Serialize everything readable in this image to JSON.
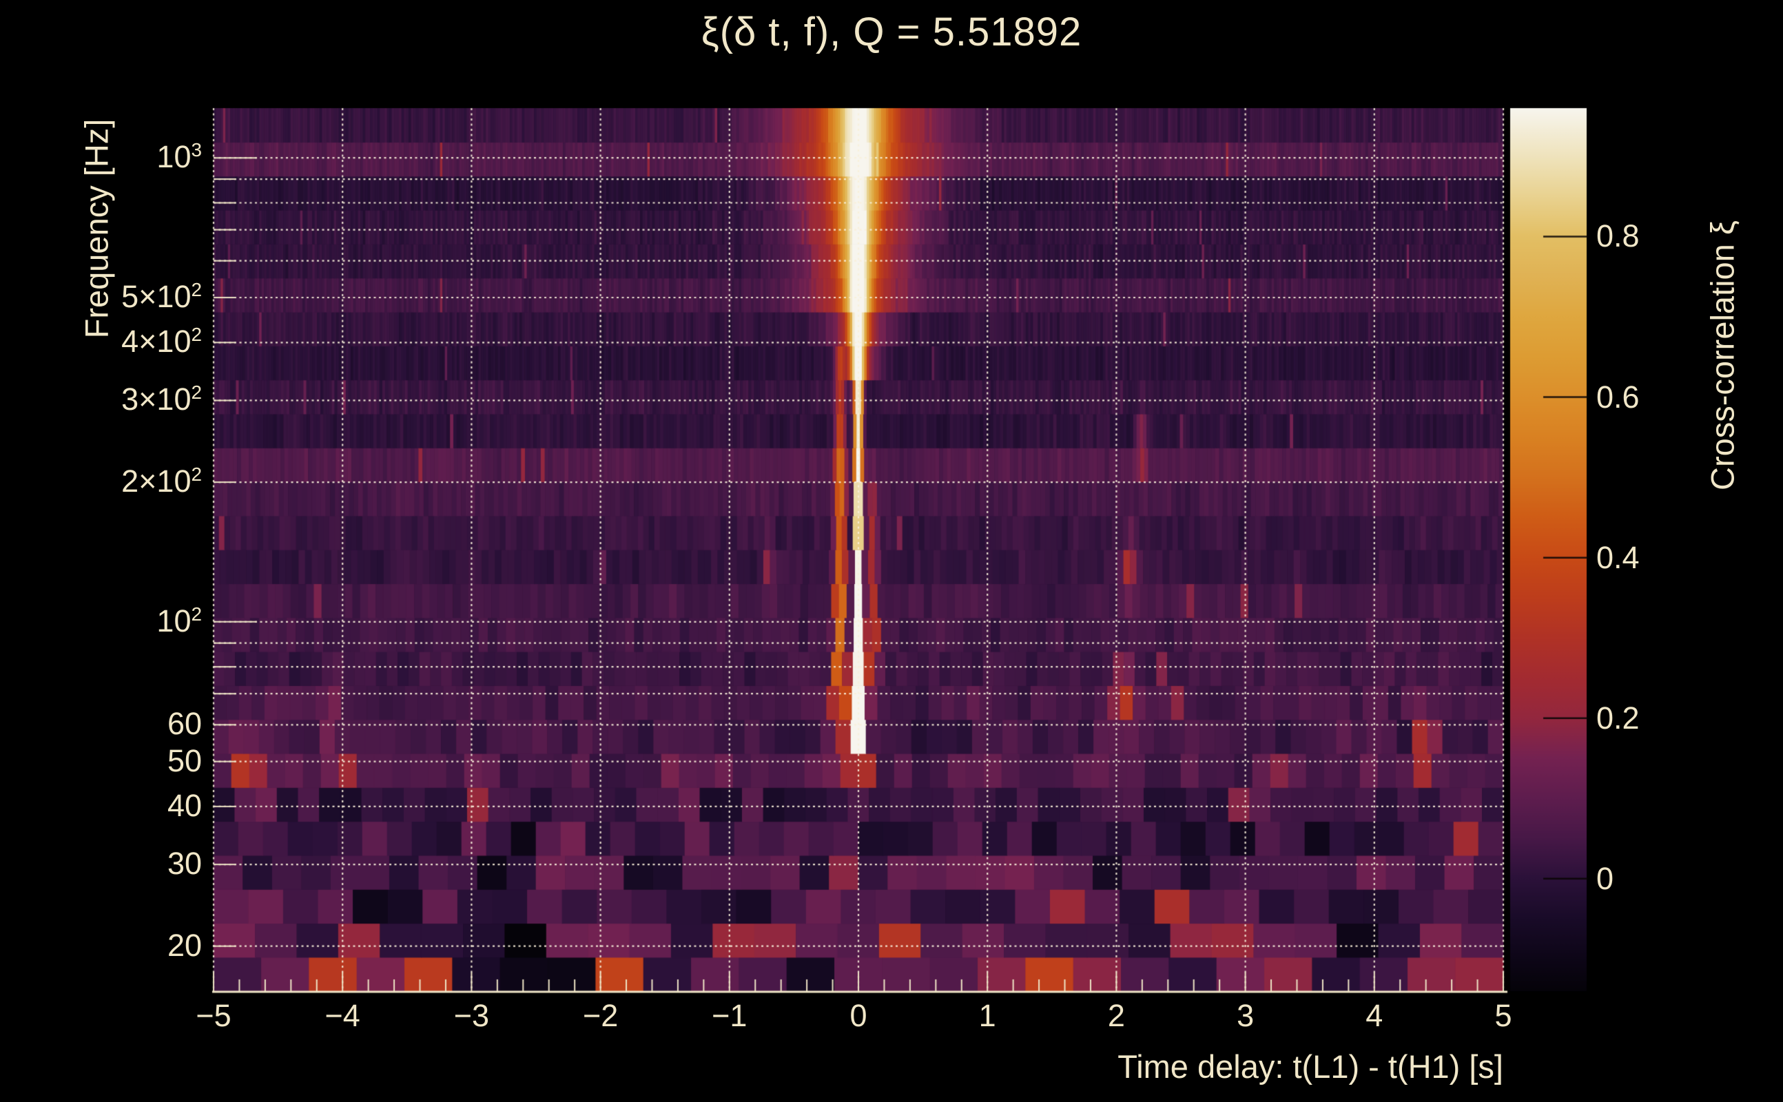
{
  "figure": {
    "background": "#000000",
    "text_color": "#f1e7c8",
    "grid_color": "#f8f0da",
    "axis_color": "#efe5c6"
  },
  "chart_data": {
    "type": "heatmap",
    "title": "ξ(δ t, f), Q = 5.51892",
    "q_value": 5.51892,
    "xlabel": "Time delay: t(L1) - t(H1) [s]",
    "ylabel": "Frequency [Hz]",
    "colorbar_label": "Cross-correlation ξ",
    "x_range": [
      -5,
      5
    ],
    "x_minor_tick_step": 0.2,
    "y_range_hz": [
      16,
      1280
    ],
    "y_scale": "log",
    "z_range": [
      -0.14,
      0.96
    ],
    "grid": {
      "style": "dotted",
      "on": true
    },
    "x_tick_labels": [
      {
        "t": -5,
        "label": "−5"
      },
      {
        "t": -4,
        "label": "−4"
      },
      {
        "t": -3,
        "label": "−3"
      },
      {
        "t": -2,
        "label": "−2"
      },
      {
        "t": -1,
        "label": "−1"
      },
      {
        "t": 0,
        "label": "0"
      },
      {
        "t": 1,
        "label": "1"
      },
      {
        "t": 2,
        "label": "2"
      },
      {
        "t": 3,
        "label": "3"
      },
      {
        "t": 4,
        "label": "4"
      },
      {
        "t": 5,
        "label": "5"
      }
    ],
    "y_tick_labels": [
      {
        "f": 1000,
        "base": "10",
        "exp": "3"
      },
      {
        "f": 500,
        "base": "5×10",
        "exp": "2"
      },
      {
        "f": 400,
        "base": "4×10",
        "exp": "2"
      },
      {
        "f": 300,
        "base": "3×10",
        "exp": "2"
      },
      {
        "f": 200,
        "base": "2×10",
        "exp": "2"
      },
      {
        "f": 100,
        "base": "10",
        "exp": "2"
      },
      {
        "f": 60,
        "base": "60",
        "exp": ""
      },
      {
        "f": 50,
        "base": "50",
        "exp": ""
      },
      {
        "f": 40,
        "base": "40",
        "exp": ""
      },
      {
        "f": 30,
        "base": "30",
        "exp": ""
      },
      {
        "f": 20,
        "base": "20",
        "exp": ""
      }
    ],
    "y_gridline_freqs": [
      20,
      30,
      40,
      50,
      60,
      70,
      80,
      90,
      100,
      200,
      300,
      400,
      500,
      600,
      700,
      800,
      900,
      1000
    ],
    "y_major_tick_freqs": [
      100,
      1000
    ],
    "colorbar_tick_labels": [
      {
        "v": 0.8,
        "label": "0.8"
      },
      {
        "v": 0.6,
        "label": "0.6"
      },
      {
        "v": 0.4,
        "label": "0.4"
      },
      {
        "v": 0.2,
        "label": "0.2"
      },
      {
        "v": 0.0,
        "label": "0"
      }
    ],
    "palette": [
      [
        0.0,
        "#050309"
      ],
      [
        0.036,
        "#0d0617"
      ],
      [
        0.082,
        "#190b28"
      ],
      [
        0.127,
        "#2b1139"
      ],
      [
        0.173,
        "#471847"
      ],
      [
        0.218,
        "#5e1d4e"
      ],
      [
        0.264,
        "#742251"
      ],
      [
        0.309,
        "#93273e"
      ],
      [
        0.355,
        "#a32b31"
      ],
      [
        0.4,
        "#b03226"
      ],
      [
        0.445,
        "#bd3d1c"
      ],
      [
        0.491,
        "#c84a16"
      ],
      [
        0.536,
        "#cf5c16"
      ],
      [
        0.582,
        "#d4711d"
      ],
      [
        0.627,
        "#d98122"
      ],
      [
        0.673,
        "#dc8f2b"
      ],
      [
        0.718,
        "#dd9c33"
      ],
      [
        0.764,
        "#dfa73f"
      ],
      [
        0.809,
        "#e0b254"
      ],
      [
        0.855,
        "#e3bf64"
      ],
      [
        0.9,
        "#e9d290"
      ],
      [
        0.945,
        "#efe3bc"
      ],
      [
        1.0,
        "#f7f5ee"
      ]
    ],
    "bands": {
      "f_min": 16,
      "f_max": 1280,
      "n_rows": 26
    },
    "peak": {
      "t0": 0,
      "amplitude_lgf": [
        [
          1.6,
          0
        ],
        [
          1.66,
          0.3
        ],
        [
          1.7,
          0.8
        ],
        [
          1.74,
          0.96
        ],
        [
          2.0,
          0.95
        ],
        [
          2.48,
          0.93
        ],
        [
          2.6,
          0.82
        ],
        [
          2.75,
          0.68
        ],
        [
          3.0,
          0.62
        ],
        [
          3.12,
          0.6
        ]
      ],
      "sigma_lgf": [
        [
          1.6,
          0.03
        ],
        [
          1.74,
          0.032
        ],
        [
          2.0,
          0.022
        ],
        [
          2.3,
          0.022
        ],
        [
          2.48,
          0.03
        ],
        [
          2.6,
          0.06
        ],
        [
          2.75,
          0.1
        ],
        [
          3.0,
          0.165
        ],
        [
          3.12,
          0.21
        ]
      ],
      "halo": {
        "min_lgf": 2.5,
        "amp": 0.26,
        "sigma_mult": 3.2
      },
      "broad": {
        "min_lgf": 2.7,
        "amp": 0.1,
        "sigma": 0.55
      },
      "secondary_left": {
        "t0": -0.14,
        "sigma": 0.035,
        "amp_lgf": [
          [
            1.7,
            0.15
          ],
          [
            1.85,
            0.45
          ],
          [
            2.35,
            0.42
          ],
          [
            2.55,
            0.25
          ],
          [
            2.62,
            0
          ]
        ]
      },
      "secondary_right": {
        "t0": 0.11,
        "sigma": 0.03,
        "amp_lgf": [
          [
            1.78,
            0
          ],
          [
            1.9,
            0.28
          ],
          [
            2.2,
            0.25
          ],
          [
            2.35,
            0
          ]
        ]
      }
    },
    "noise": {
      "base": 0.025,
      "row_jitter": 0.05,
      "amp_base": 0.05,
      "amp_peak": 0.25,
      "amp_center_lgf": 1.15,
      "amp_sigma_lgf": 0.45,
      "sparse_bright_prob": 0.008,
      "sparse_bright_add": 0.12
    },
    "hotspots": [
      {
        "t": -4.75,
        "f": 48,
        "a": 0.26,
        "st": 0.1
      },
      {
        "t": -4.3,
        "f": 17,
        "a": 0.3,
        "st": 0.15
      },
      {
        "t": -4.1,
        "f": 60,
        "a": 0.2,
        "st": 0.07
      },
      {
        "t": -3.9,
        "f": 21,
        "a": 0.24,
        "st": 0.12
      },
      {
        "t": -3.4,
        "f": 17,
        "a": 0.42,
        "st": 0.12
      },
      {
        "t": -3.35,
        "f": 26,
        "a": 0.28,
        "st": 0.1
      },
      {
        "t": -2.95,
        "f": 38,
        "a": 0.2,
        "st": 0.1
      },
      {
        "t": -2.3,
        "f": 30,
        "a": 0.26,
        "st": 0.12
      },
      {
        "t": -1.85,
        "f": 17,
        "a": 0.28,
        "st": 0.1
      },
      {
        "t": -1.4,
        "f": 44,
        "a": 0.2,
        "st": 0.08
      },
      {
        "t": -0.95,
        "f": 24,
        "a": 0.3,
        "st": 0.1
      },
      {
        "t": -0.7,
        "f": 130,
        "a": 0.18,
        "st": 0.05
      },
      {
        "t": -0.55,
        "f": 33,
        "a": 0.22,
        "st": 0.08
      },
      {
        "t": 0.45,
        "f": 21,
        "a": 0.34,
        "st": 0.12
      },
      {
        "t": 0.9,
        "f": 28,
        "a": 0.24,
        "st": 0.08
      },
      {
        "t": 1.5,
        "f": 18,
        "a": 0.3,
        "st": 0.12
      },
      {
        "t": 2.05,
        "f": 70,
        "a": 0.34,
        "st": 0.06
      },
      {
        "t": 2.1,
        "f": 130,
        "a": 0.24,
        "st": 0.06
      },
      {
        "t": 2.2,
        "f": 240,
        "a": 0.18,
        "st": 0.05
      },
      {
        "t": 2.5,
        "f": 23,
        "a": 0.26,
        "st": 0.1
      },
      {
        "t": 3.2,
        "f": 45,
        "a": 0.22,
        "st": 0.08
      },
      {
        "t": 3.3,
        "f": 17,
        "a": 0.28,
        "st": 0.1
      },
      {
        "t": 4.3,
        "f": 17,
        "a": 0.44,
        "st": 0.15
      },
      {
        "t": 4.4,
        "f": 55,
        "a": 0.34,
        "st": 0.08
      },
      {
        "t": 4.75,
        "f": 30,
        "a": 0.24,
        "st": 0.1
      }
    ],
    "description": "Q-transform cross-correlation spectrogram: dark purple noise field with a bright near-white vertical ridge at time delay ≈ 0 s spanning ~50–1280 Hz, widening into an orange plume at high frequency; mottled red/orange noise below ~60 Hz."
  }
}
